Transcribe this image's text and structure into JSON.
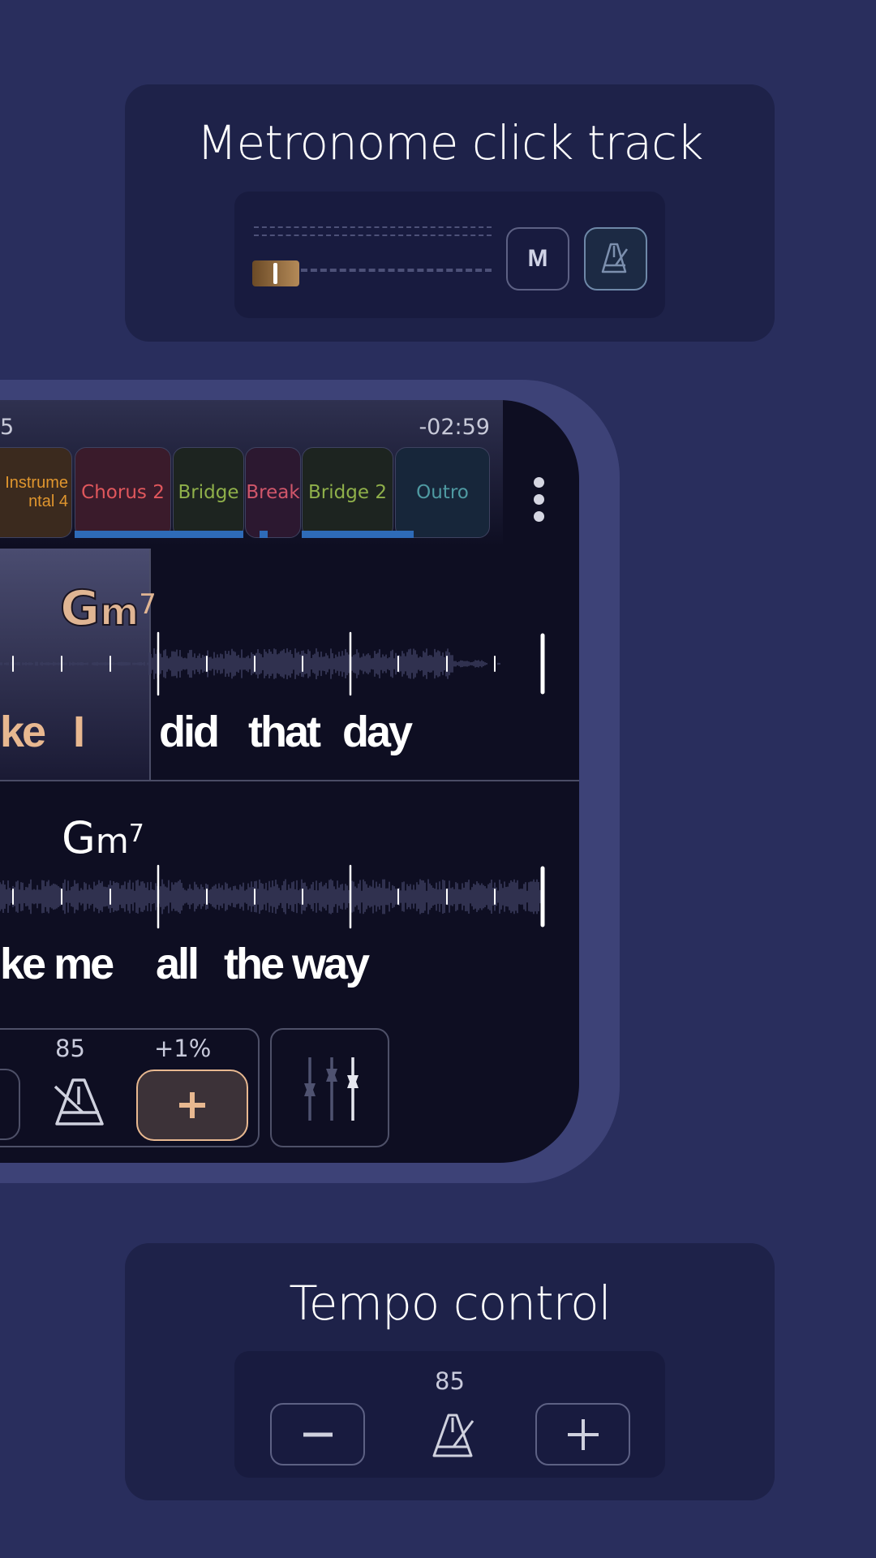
{
  "metronome_card": {
    "title": "Metronome click track",
    "volume_level": 0.0,
    "mute_label": "M",
    "metronome_icon": "metronome-icon"
  },
  "player": {
    "elapsed_partial": "5",
    "remaining_time": "-02:59",
    "sections": [
      {
        "label": "Instrumental 4",
        "visible_label": "mental 4",
        "color": "#e0962e",
        "bg": "#3b2a1e"
      },
      {
        "label": "Chorus 2",
        "color": "#e0575c",
        "bg": "#3a1b2b"
      },
      {
        "label": "Bridge",
        "color": "#8fb04a",
        "bg": "#1d2420"
      },
      {
        "label": "Break",
        "color": "#d0566a",
        "bg": "#2c1830"
      },
      {
        "label": "Bridge 2",
        "color": "#8fb04a",
        "bg": "#1d2420"
      },
      {
        "label": "Outro",
        "color": "#4f9aa2",
        "bg": "#17263a"
      }
    ],
    "more_icon": "more-vertical-icon",
    "lines": [
      {
        "chord_root": "G",
        "chord_quality": "m",
        "chord_ext": "7",
        "words": [
          "ke",
          "I",
          "did",
          "that",
          "day"
        ],
        "sung_words": 2
      },
      {
        "chord_root": "G",
        "chord_quality": "m",
        "chord_ext": "7",
        "words": [
          "ke me",
          "all",
          "the way"
        ],
        "sung_words": 0
      }
    ],
    "tempo_bpm": "85",
    "tempo_change": "+1%",
    "accent_color": "#e8b890",
    "mixer_icon": "mixer-sliders-icon"
  },
  "tempo_card": {
    "title": "Tempo control",
    "bpm": "85",
    "minus_icon": "minus-icon",
    "plus_icon": "plus-icon"
  }
}
